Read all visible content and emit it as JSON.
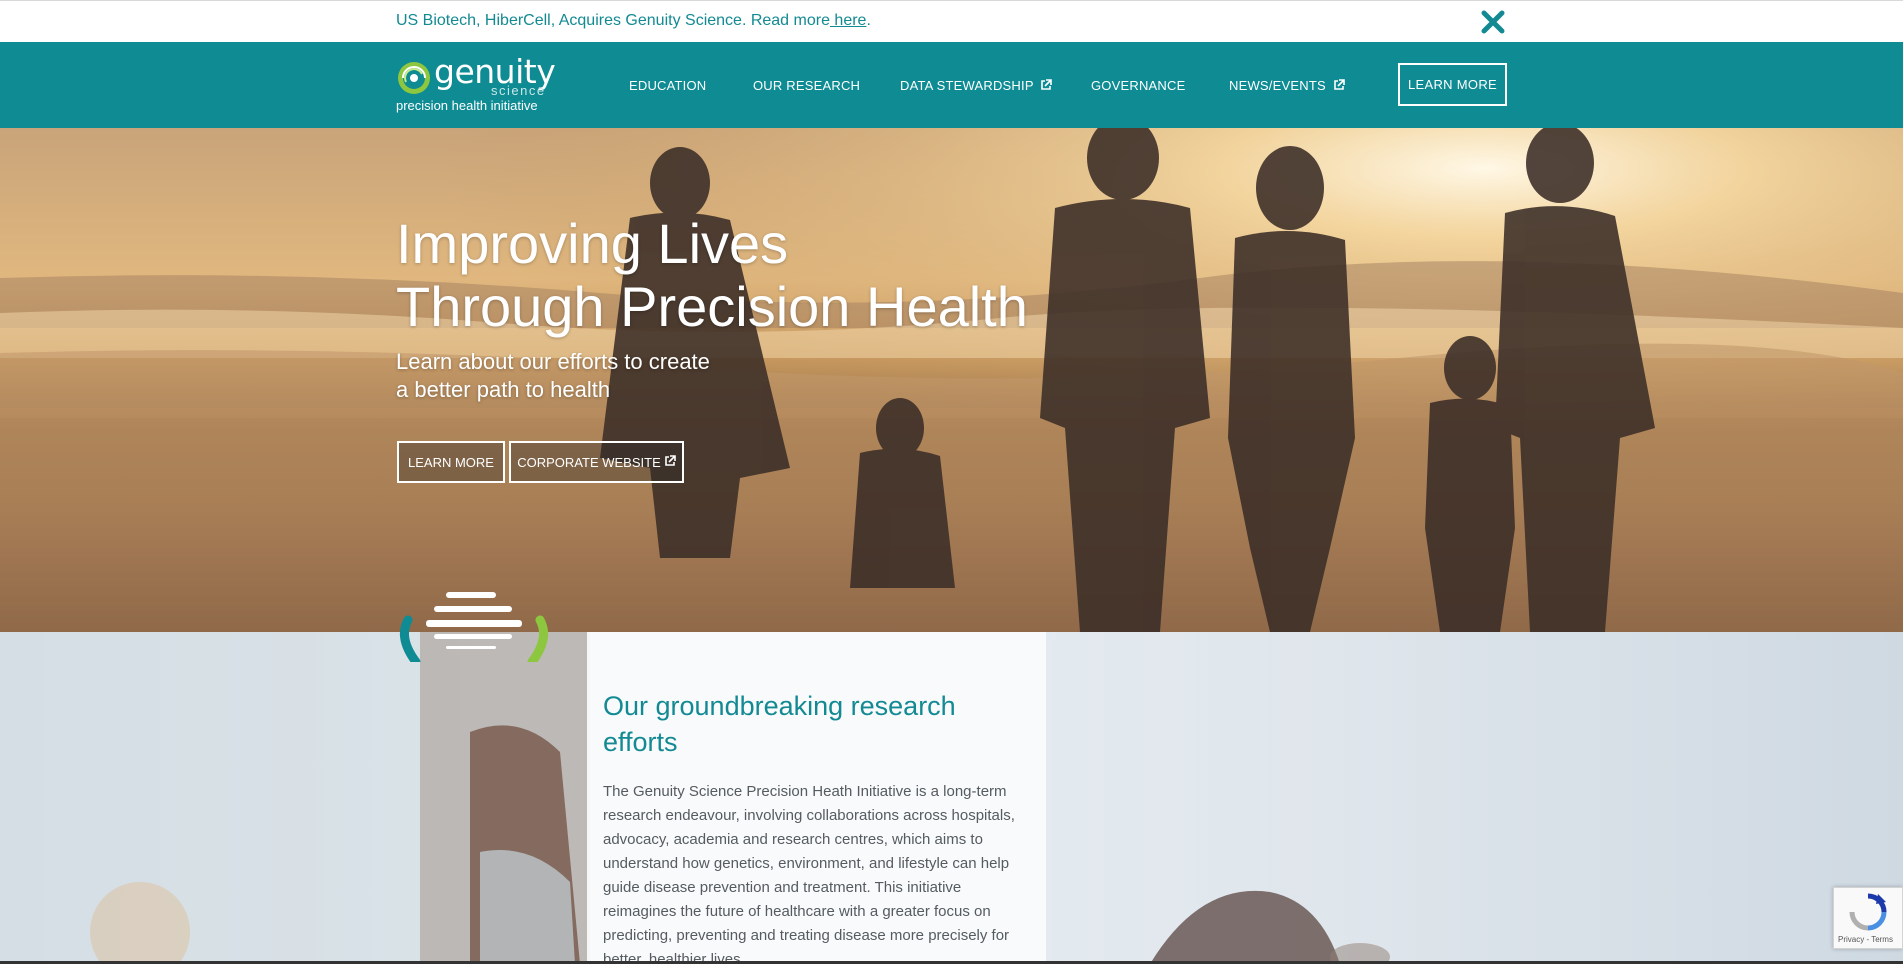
{
  "announcement": {
    "text": "US Biotech, HiberCell, Acquires Genuity Science. Read more",
    "link_label": " here",
    "suffix": ".",
    "close_icon": "close-icon"
  },
  "header": {
    "logo_word": "genuity",
    "logo_science": "science",
    "logo_tagline": "precision health initiative",
    "nav": [
      {
        "label": "EDUCATION",
        "external": false
      },
      {
        "label": "OUR RESEARCH",
        "external": false
      },
      {
        "label": "DATA STEWARDSHIP",
        "external": true
      },
      {
        "label": "GOVERNANCE",
        "external": false
      },
      {
        "label": "NEWS/EVENTS",
        "external": true
      }
    ],
    "cta_label": "LEARN MORE"
  },
  "hero": {
    "title_line1": "Improving Lives",
    "title_line2": "Through Precision Health",
    "sub_line1": "Learn about our efforts to create",
    "sub_line2": "a better path to health",
    "learn_more_label": "LEARN MORE",
    "corporate_label": "CORPORATE WEBSITE"
  },
  "research": {
    "title": "Our groundbreaking research efforts",
    "body": "The Genuity Science Precision Heath Initiative is a long-term research endeavour, involving collaborations across hospitals, advocacy, academia and research centres, which aims to understand how genetics, environment, and lifestyle can help guide disease prevention and treatment. This initiative reimagines the future of healthcare with a greater focus on predicting, preventing and treating disease more precisely for better, healthier lives."
  },
  "recaptcha": {
    "links": "Privacy - Terms"
  },
  "colors": {
    "brand_teal": "#0e8b93",
    "accent_green": "#8dc63f",
    "text_teal": "#138a93"
  }
}
